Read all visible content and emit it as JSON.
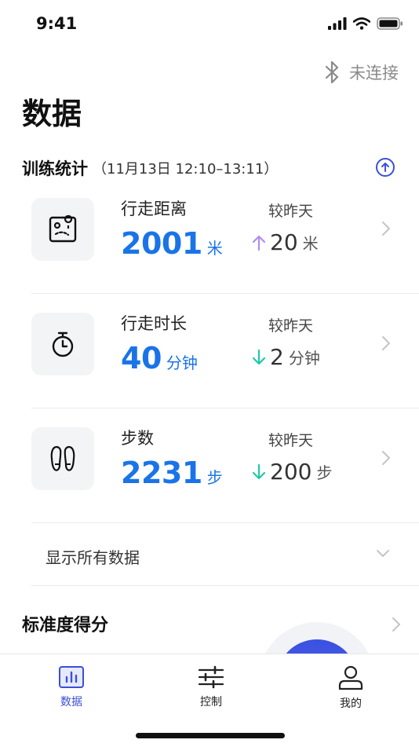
{
  "status_bar": {
    "time": "9:41"
  },
  "header": {
    "bluetooth_status": "未连接",
    "title": "数据"
  },
  "training": {
    "title": "训练统计",
    "subtitle": "（11月13日 12:10–13:11）",
    "rows": [
      {
        "label": "行走距离",
        "value": "2001",
        "unit": "米",
        "compare_label": "较昨天",
        "compare_direction": "up",
        "compare_value": "20",
        "compare_unit": "米",
        "icon": "map-icon"
      },
      {
        "label": "行走时长",
        "value": "40",
        "unit": "分钟",
        "compare_label": "较昨天",
        "compare_direction": "down",
        "compare_value": "2",
        "compare_unit": "分钟",
        "icon": "stopwatch-icon"
      },
      {
        "label": "步数",
        "value": "2231",
        "unit": "步",
        "compare_label": "较昨天",
        "compare_direction": "down",
        "compare_value": "200",
        "compare_unit": "步",
        "icon": "footprints-icon"
      }
    ],
    "show_all_label": "显示所有数据"
  },
  "score": {
    "title": "标准度得分"
  },
  "tab_bar": {
    "tabs": [
      {
        "label": "数据",
        "active": true,
        "icon": "bar-chart-icon"
      },
      {
        "label": "控制",
        "active": false,
        "icon": "sliders-icon"
      },
      {
        "label": "我的",
        "active": false,
        "icon": "user-icon"
      }
    ]
  },
  "colors": {
    "accent": "#1a74e8",
    "tab_active": "#3a4fd8",
    "arrow_up": "#b48cf0",
    "arrow_down": "#1ec9a8"
  }
}
